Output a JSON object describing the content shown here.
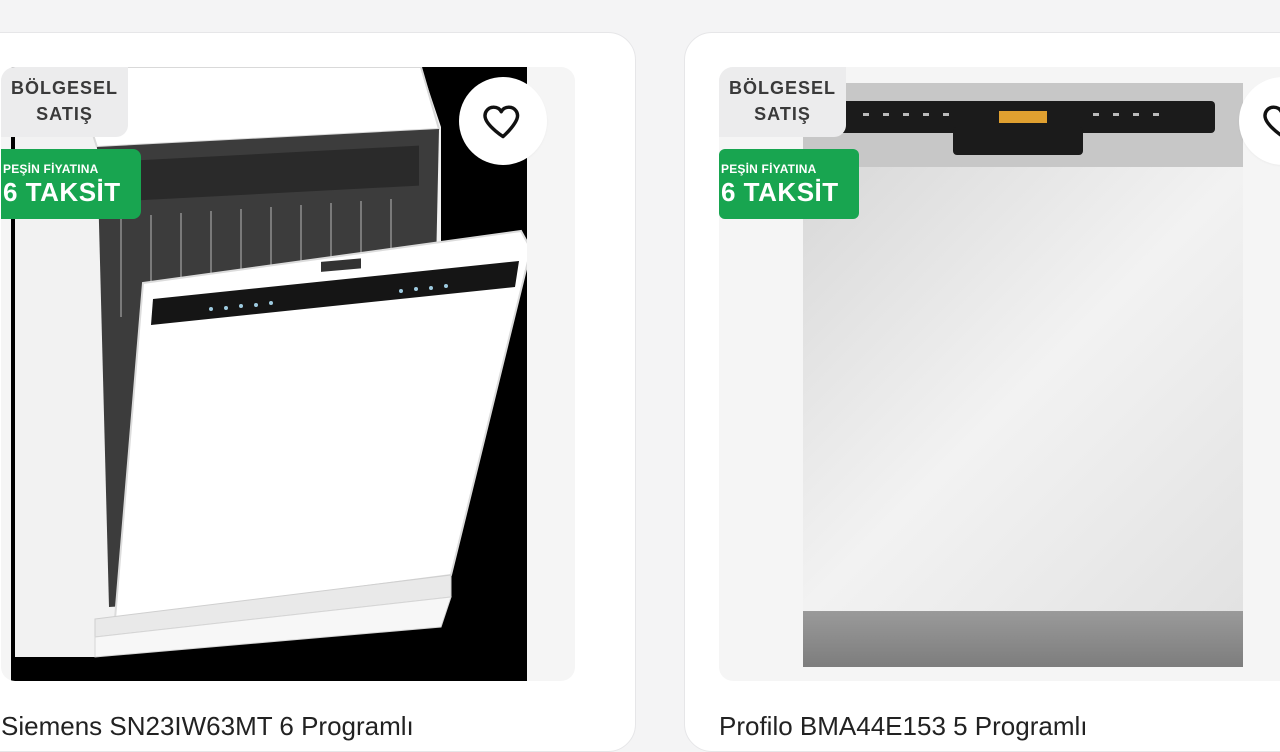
{
  "products": [
    {
      "badge_regional": [
        "BÖLGESEL",
        "SATIŞ"
      ],
      "badge_installment_small": "PEŞİN FİYATINA",
      "badge_installment_big": "6 TAKSİT",
      "title": "Siemens SN23IW63MT 6 Programlı"
    },
    {
      "badge_regional": [
        "BÖLGESEL",
        "SATIŞ"
      ],
      "badge_installment_small": "PEŞİN FİYATINA",
      "badge_installment_big": "6 TAKSİT",
      "title": "Profilo BMA44E153 5 Programlı"
    }
  ],
  "icons": {
    "favorite": "heart-outline-icon"
  },
  "colors": {
    "installment_badge": "#18a550",
    "card_bg": "#ffffff",
    "page_bg": "#f4f4f5"
  }
}
